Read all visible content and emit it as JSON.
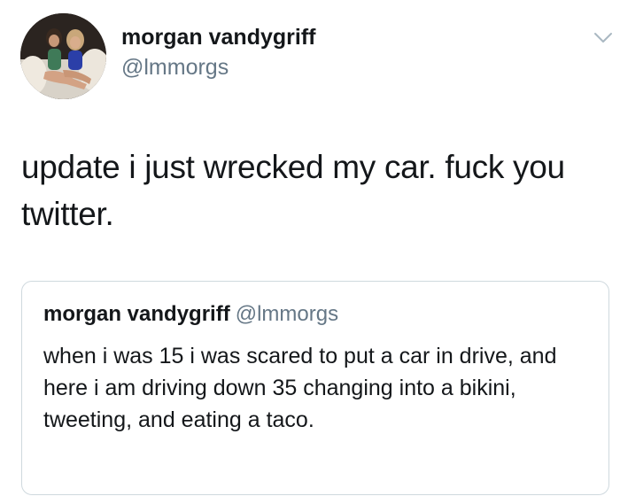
{
  "author": {
    "display_name": "morgan vandygriff",
    "handle": "@lmmorgs",
    "avatar_icon": "profile-photo"
  },
  "menu": {
    "icon": "chevron-down-icon"
  },
  "tweet": {
    "text": "update i just wrecked my car. fuck you twitter."
  },
  "quoted_tweet": {
    "display_name": "morgan vandygriff",
    "handle": "@lmmorgs",
    "text": "when i was 15 i was scared to put a car in drive, and here i am driving down 35 changing into a bikini, tweeting, and eating a taco."
  },
  "colors": {
    "text_primary": "#14171a",
    "text_secondary": "#657786",
    "border": "#cfd9de"
  }
}
